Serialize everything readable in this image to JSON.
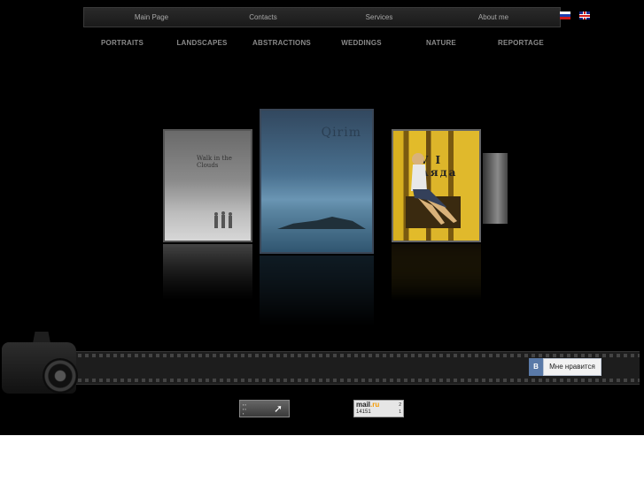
{
  "nav": {
    "items": [
      "Main Page",
      "Contacts",
      "Services",
      "About me"
    ],
    "languages": [
      "ru",
      "en"
    ]
  },
  "categories": [
    "PORTRAITS",
    "LANDSCAPES",
    "ABSTRACTIONS",
    "WEDDINGS",
    "NATURE",
    "REPORTAGE"
  ],
  "gallery": {
    "covers": [
      {
        "title": "Walk in the Clouds"
      },
      {
        "title": "Qirim"
      },
      {
        "title": "V I Аяда"
      }
    ]
  },
  "like": {
    "icon_letter": "B",
    "label": "Мне нравится"
  },
  "counters": {
    "mailru": {
      "logo_main": "mail",
      "logo_dot": ".ru",
      "value": "14151",
      "side_top": "2",
      "side_bottom": "1"
    }
  },
  "colors": {
    "background": "#000000",
    "nav_text": "#a8a8a8",
    "category_text": "#8a8a8a",
    "like_accent": "#5a7aa8"
  }
}
